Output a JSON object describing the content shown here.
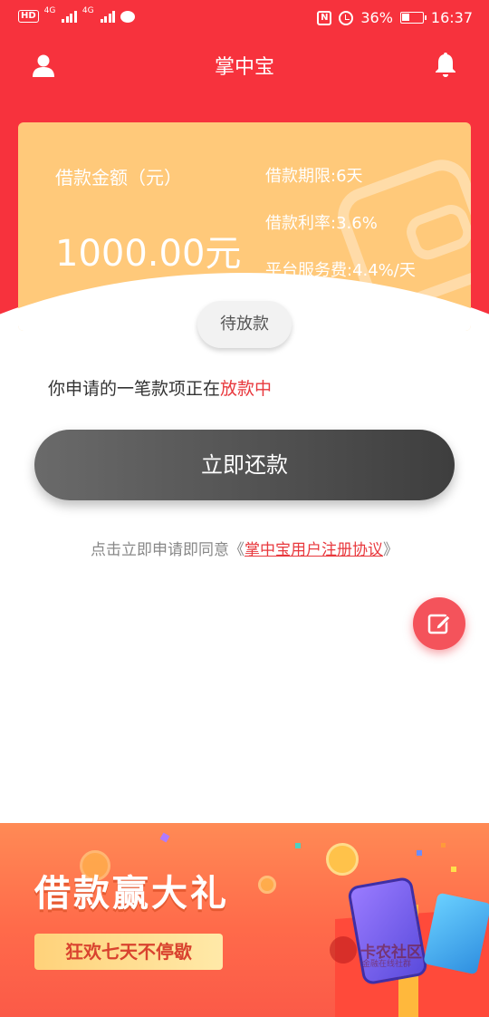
{
  "status_bar": {
    "hd_badge": "HD",
    "network_1": "4G",
    "network_2": "4G",
    "battery_percent": "36%",
    "time": "16:37"
  },
  "header": {
    "title": "掌中宝",
    "left_icon": "user-icon",
    "right_icon": "bell-icon"
  },
  "loan_card": {
    "amount_label": "借款金额（元）",
    "amount_value": "1000.00元",
    "term": "借款期限:6天",
    "rate": "借款利率:3.6%",
    "service_fee": "平台服务费:4.4%/天"
  },
  "status_pill": "待放款",
  "progress": {
    "prefix": "你申请的一笔款项正在",
    "highlight": "放款中"
  },
  "repay_button": "立即还款",
  "agreement": {
    "prefix": "点击立即申请即同意《",
    "link": "掌中宝用户注册协议",
    "suffix": "》"
  },
  "fab_icon": "edit-icon",
  "banner": {
    "title": "借款赢大礼",
    "subtitle": "狂欢七天不停歇",
    "watermark": "卡农社区",
    "watermark_small": "金融在线社群"
  },
  "colors": {
    "brand_red": "#f7323d",
    "card_orange": "#ffc97a",
    "highlight_red": "#e8383d",
    "button_dark": "#4a4a4a"
  }
}
